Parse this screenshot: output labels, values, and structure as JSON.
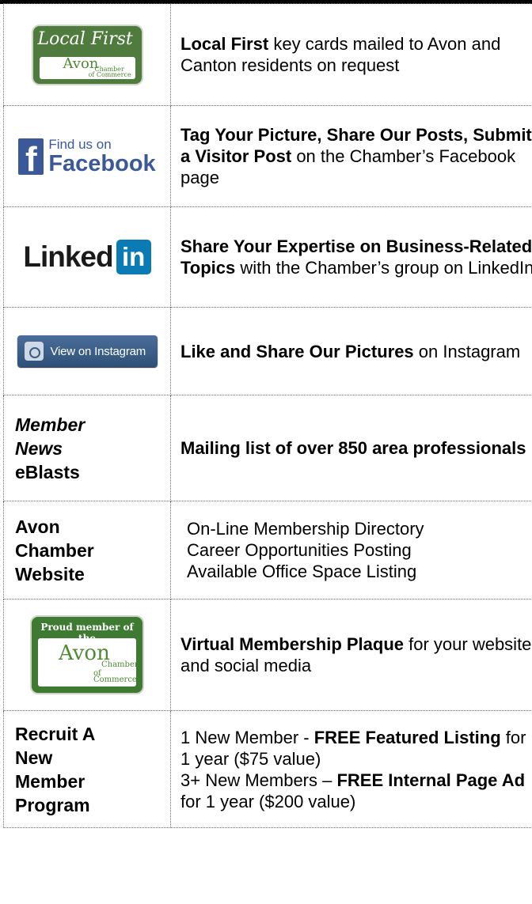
{
  "rows": [
    {
      "logo": {
        "title": "Local First",
        "word": "Avon",
        "sub1": "Chamber",
        "sub2": "of Commerce"
      },
      "desc_bold": "Local First",
      "desc_rest": " key cards mailed to Avon and Canton residents on request"
    },
    {
      "logo": {
        "find": "Find us on",
        "name": "Facebook",
        "letter": "f"
      },
      "desc_bold": "Tag Your Picture, Share Our Posts, Submit a Visitor Post",
      "desc_rest": " on the Chamber’s Facebook page"
    },
    {
      "logo": {
        "word": "Linked",
        "box": "in"
      },
      "desc_bold": "Share Your Expertise on Business-Related Topics",
      "desc_rest": " with the Chamber’s group on LinkedIn"
    },
    {
      "logo": {
        "label": "View on Instagram"
      },
      "desc_bold": "Like and Share Our Pictures",
      "desc_rest": " on Instagram"
    },
    {
      "heading_line1": "Member",
      "heading_line2": "News",
      "heading_line3": "eBlasts",
      "desc_bold": "Mailing list of over 850 area professionals"
    },
    {
      "heading_line1": "Avon",
      "heading_line2": "Chamber",
      "heading_line3": "Website",
      "items": [
        "On-Line Membership Directory",
        "Career Opportunities Posting",
        "Available Office Space Listing"
      ]
    },
    {
      "logo": {
        "title": "Proud member of the",
        "word": "Avon",
        "sub1": "Chamber",
        "sub2": "of Commerce"
      },
      "desc_bold": "Virtual Membership Plaque",
      "desc_rest": " for your website and social media"
    },
    {
      "heading_line1": "Recruit A",
      "heading_line2": "New",
      "heading_line3": "Member",
      "heading_line4": "Program",
      "line1_plain": "1 New Member - ",
      "line1_bold": "FREE Featured Listing",
      "line1_rest": " for 1 year ($75 value)",
      "line2_plain": "3+ New Members – ",
      "line2_bold": "FREE Internal Page Ad",
      "line2_rest": " for 1 year ($200 value)"
    }
  ]
}
